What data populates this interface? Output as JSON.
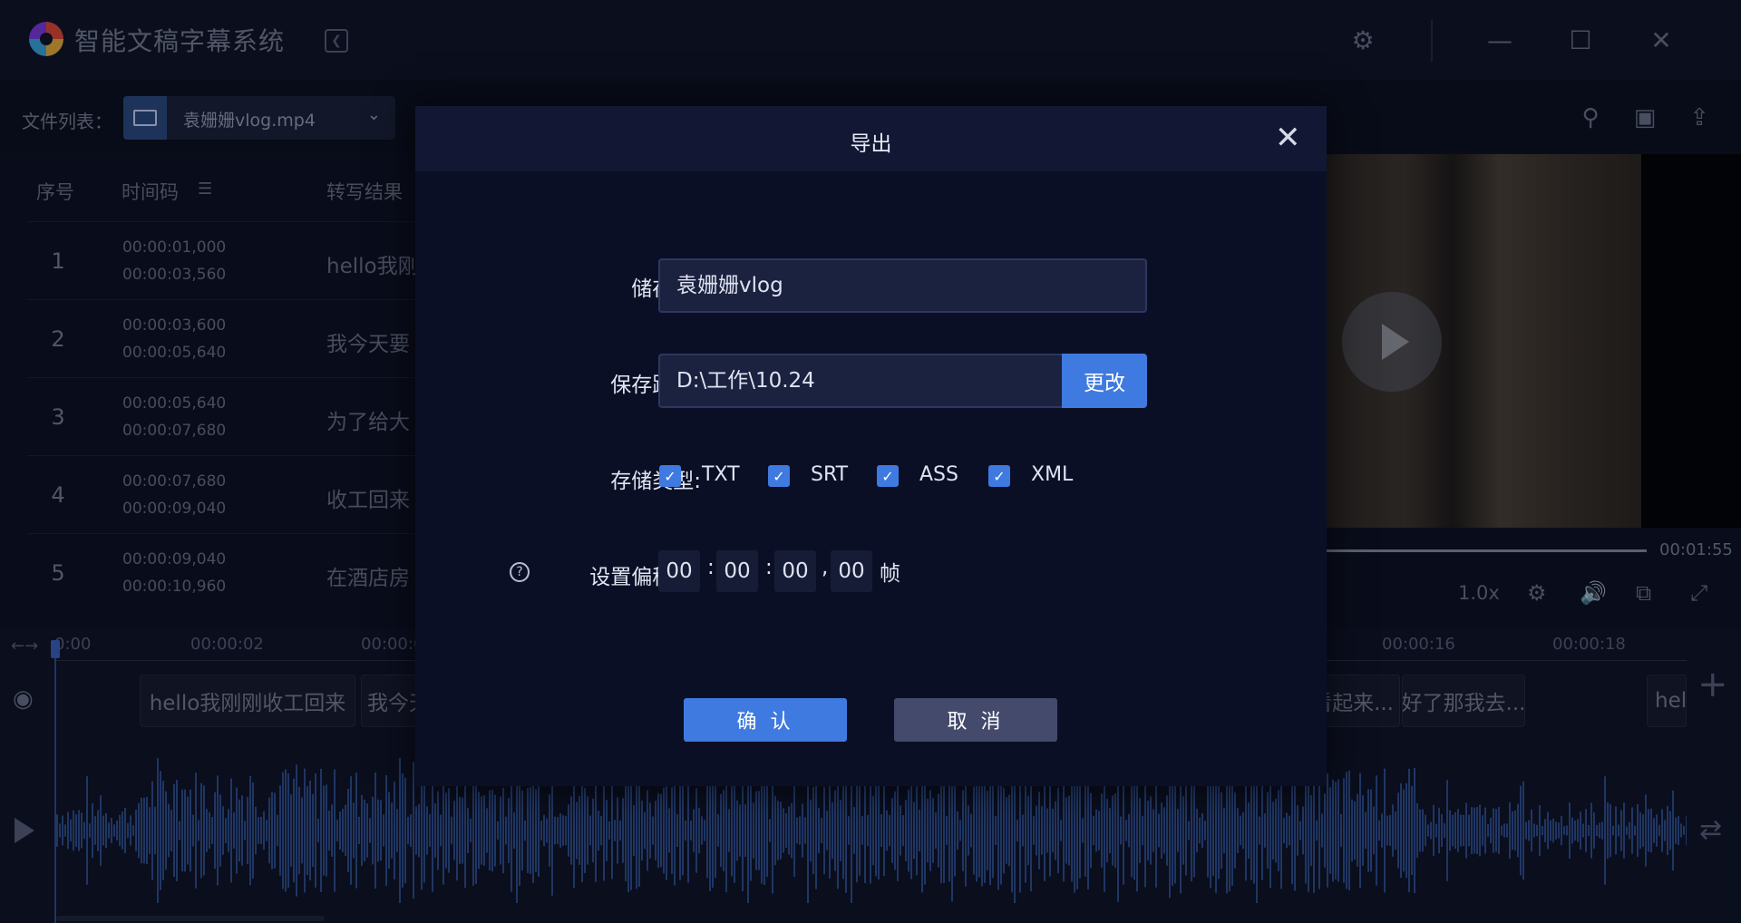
{
  "app": {
    "title": "智能文稿字幕系统"
  },
  "window_icons": [
    "gear-icon",
    "minimize-icon",
    "maximize-icon",
    "close-icon"
  ],
  "toolbar": {
    "file_label": "文件列表：",
    "file_name": "袁姗姗vlog.mp4",
    "icons": [
      "search-icon",
      "save-icon",
      "upload-icon"
    ]
  },
  "table": {
    "headers": {
      "index": "序号",
      "timecode": "时间码",
      "result": "转写结果"
    },
    "rows": [
      {
        "index": "1",
        "start": "00:00:01,000",
        "end": "00:00:03,560",
        "text": "hello我刚"
      },
      {
        "index": "2",
        "start": "00:00:03,600",
        "end": "00:00:05,640",
        "text": "我今天要"
      },
      {
        "index": "3",
        "start": "00:00:05,640",
        "end": "00:00:07,680",
        "text": "为了给大"
      },
      {
        "index": "4",
        "start": "00:00:07,680",
        "end": "00:00:09,040",
        "text": "收工回来"
      },
      {
        "index": "5",
        "start": "00:00:09,040",
        "end": "00:00:10,960",
        "text": "在酒店房"
      }
    ]
  },
  "player": {
    "duration": "00:01:55",
    "speed": "1.0x"
  },
  "timeline": {
    "ticks": [
      "0:00",
      "00:00:02",
      "00:00:0",
      "00:00:16",
      "00:00:18"
    ],
    "clips": [
      "hello我刚刚收工回来",
      "我今天",
      "看起来...",
      "好了那我去...",
      "hel"
    ]
  },
  "dialog": {
    "title": "导出",
    "save_as_label": "储存为:",
    "save_as_value": "袁姗姗vlog",
    "path_label": "保存路径:",
    "path_value": "D:\\工作\\10.24",
    "change_button": "更改",
    "type_label": "存储类型:",
    "types": [
      {
        "name": "TXT",
        "checked": true
      },
      {
        "name": "SRT",
        "checked": true
      },
      {
        "name": "ASS",
        "checked": true
      },
      {
        "name": "XML",
        "checked": true
      }
    ],
    "offset_label": "设置偏移量:",
    "offset": {
      "h": "00",
      "m": "00",
      "s": "00",
      "f": "00",
      "unit": "帧"
    },
    "confirm_button": "确 认",
    "cancel_button": "取 消"
  }
}
